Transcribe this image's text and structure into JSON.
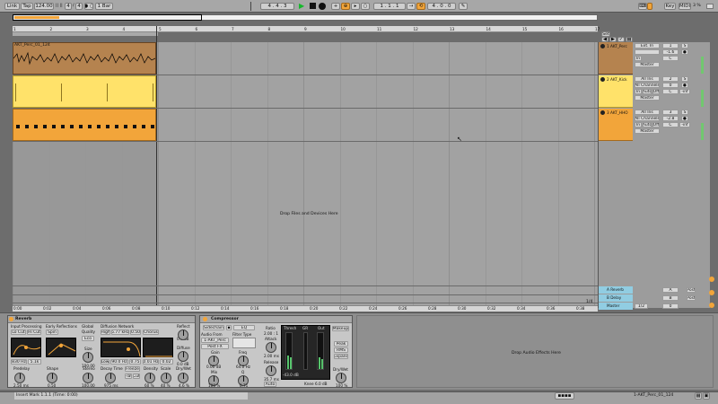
{
  "transport": {
    "link": "Link",
    "tap": "Tap",
    "tempo": "124.00",
    "signature_num": "4",
    "signature_den": "4",
    "quantize": "1 Bar",
    "arrangement_pos": "4 . 4 . 3",
    "loop_start": "1 . 1 . 1",
    "loop_end": "4 . 0 . 0",
    "key": "Key",
    "midi": "MIDI",
    "cpu": "3 %"
  },
  "ruler": {
    "bars": [
      "1",
      "2",
      "3",
      "4",
      "5",
      "6",
      "7",
      "8",
      "9",
      "10",
      "11",
      "12",
      "13",
      "14",
      "15",
      "16",
      "17"
    ],
    "times": [
      "0:00",
      "0:02",
      "0:04",
      "0:06",
      "0:08",
      "0:10",
      "0:12",
      "0:14",
      "0:16",
      "0:18",
      "0:20",
      "0:22",
      "0:24",
      "0:26",
      "0:28",
      "0:30",
      "0:32",
      "0:34",
      "0:36",
      "0:38"
    ],
    "set_label": "Set",
    "zoom_fraction": "1/4"
  },
  "tracks": [
    {
      "name": "1 AKT_Perc",
      "input": "Ext. In",
      "monitor": "In",
      "output": "Master",
      "number": "1",
      "clip": "AKT_Perc_01_124",
      "color": "#b5834f"
    },
    {
      "name": "2 AKT_Kick",
      "input": "All Ins",
      "channel": "All Channels",
      "monitor": "In",
      "output": "Master",
      "number": "2",
      "color": "#ffe26a"
    },
    {
      "name": "3 AKT_HHO",
      "input": "All Ins",
      "channel": "All Channels",
      "monitor": "In",
      "output": "Master",
      "number": "3",
      "color": "#f2a53a"
    }
  ],
  "returns": [
    {
      "name": "A Reverb",
      "number": "A",
      "color": "#91cde2"
    },
    {
      "name": "B Delay",
      "number": "B",
      "color": "#91cde2"
    }
  ],
  "master": {
    "name": "Master",
    "cue": "1/2"
  },
  "drop_hint": "Drop Files and Devices Here",
  "devices": {
    "reverb": {
      "title": "Reverb",
      "sections": [
        "Input Processing",
        "Early Reflections",
        "Global",
        "Diffusion Network",
        "Reflect",
        "Diffuse"
      ],
      "input_labels": [
        "Lo Cut",
        "Hi Cut"
      ],
      "spin": "Spin",
      "quality": "Quality",
      "quality_value": "Eco",
      "diffusion_labels": [
        "High",
        "Low",
        "Chorus"
      ],
      "diffusion_values": [
        "5.77 kHz",
        "0.50",
        "90.0 Hz",
        "0.75",
        "0.01 Hz",
        "0.02"
      ],
      "freq_values": [
        "830 Hz",
        "5.1k"
      ],
      "size": "Size",
      "size_value": "100.00",
      "predelay": "Predelay",
      "predelay_value": "2.50 ms",
      "shape": "Shape",
      "shape_value": "0.50",
      "stereo": "Stereo",
      "stereo_value": "100.00",
      "decay": "Decay Time",
      "decay_value": "975 ms",
      "freeze": "Freeze",
      "flat": "Flat",
      "cut": "Cut",
      "density": "Density",
      "density_value": "60 %",
      "scale": "Scale",
      "scale_value": "40 %",
      "drywet": "Dry/Wet",
      "drywet_value": "4.6 %",
      "reflect_value": "0.0 dB",
      "diffuse_value": "0.0 dB"
    },
    "compressor": {
      "title": "Compressor",
      "sidechain": "Sidechain",
      "eq": "EQ",
      "audio_from": "Audio From",
      "audio_from_value": "1-AKT_Perc",
      "post_fx": "Post FX",
      "filter_type": "Filter Type",
      "gain": "Gain",
      "gain_value": "0.00 dB",
      "freq": "Freq",
      "freq_value": "64.0 Hz",
      "mix": "Mix",
      "mix_value": "100 %",
      "q": "Q",
      "q_value": "0.71",
      "ratio": "Ratio",
      "ratio_value": "2.00 : 1",
      "attack": "Attack",
      "attack_value": "2.00 ms",
      "release": "Release",
      "release_value": "35.7 ms",
      "auto": "Auto",
      "thresh": "Thresh",
      "gr": "GR",
      "out": "Out",
      "thresh_value": "-43.0 dB",
      "knee": "Knee",
      "knee_value": "6.0 dB",
      "modes": [
        "Peak",
        "RMS",
        "Expand"
      ],
      "makeup": "Makeup",
      "drywet": "Dry/Wet",
      "drywet_value": "100 %"
    }
  },
  "drop_effects": "Drop Audio Effects Here",
  "status": {
    "insert_mark": "Insert Mark 1.1.1 (Time: 0:00)",
    "clip_name": "1-AKT_Perc_01_124"
  }
}
